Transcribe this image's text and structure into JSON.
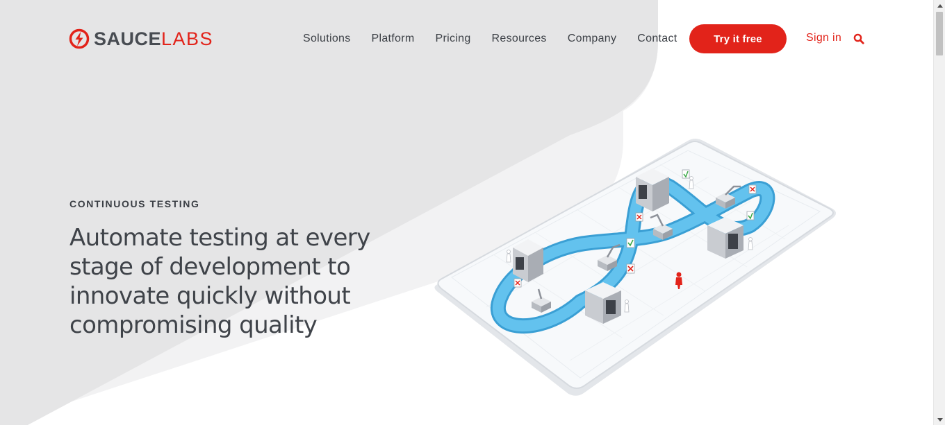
{
  "brand": {
    "name_part1": "SAUCE",
    "name_part2": "LABS",
    "accent_color": "#e2231a",
    "text_color": "#484c52"
  },
  "nav": {
    "items": [
      "Solutions",
      "Platform",
      "Pricing",
      "Resources",
      "Company",
      "Contact"
    ]
  },
  "header": {
    "cta_label": "Try it free",
    "signin_label": "Sign in",
    "search_icon": "search-icon"
  },
  "hero": {
    "eyebrow": "CONTINUOUS TESTING",
    "headline": "Automate testing at every stage of development to innovate quickly without compromising quality",
    "illustration": "infinity-conveyor-testing-illustration"
  },
  "colors": {
    "background_shape": "#e6e6e7",
    "background_shape_light": "#f1f1f2",
    "conveyor": "#4fb5e6"
  }
}
